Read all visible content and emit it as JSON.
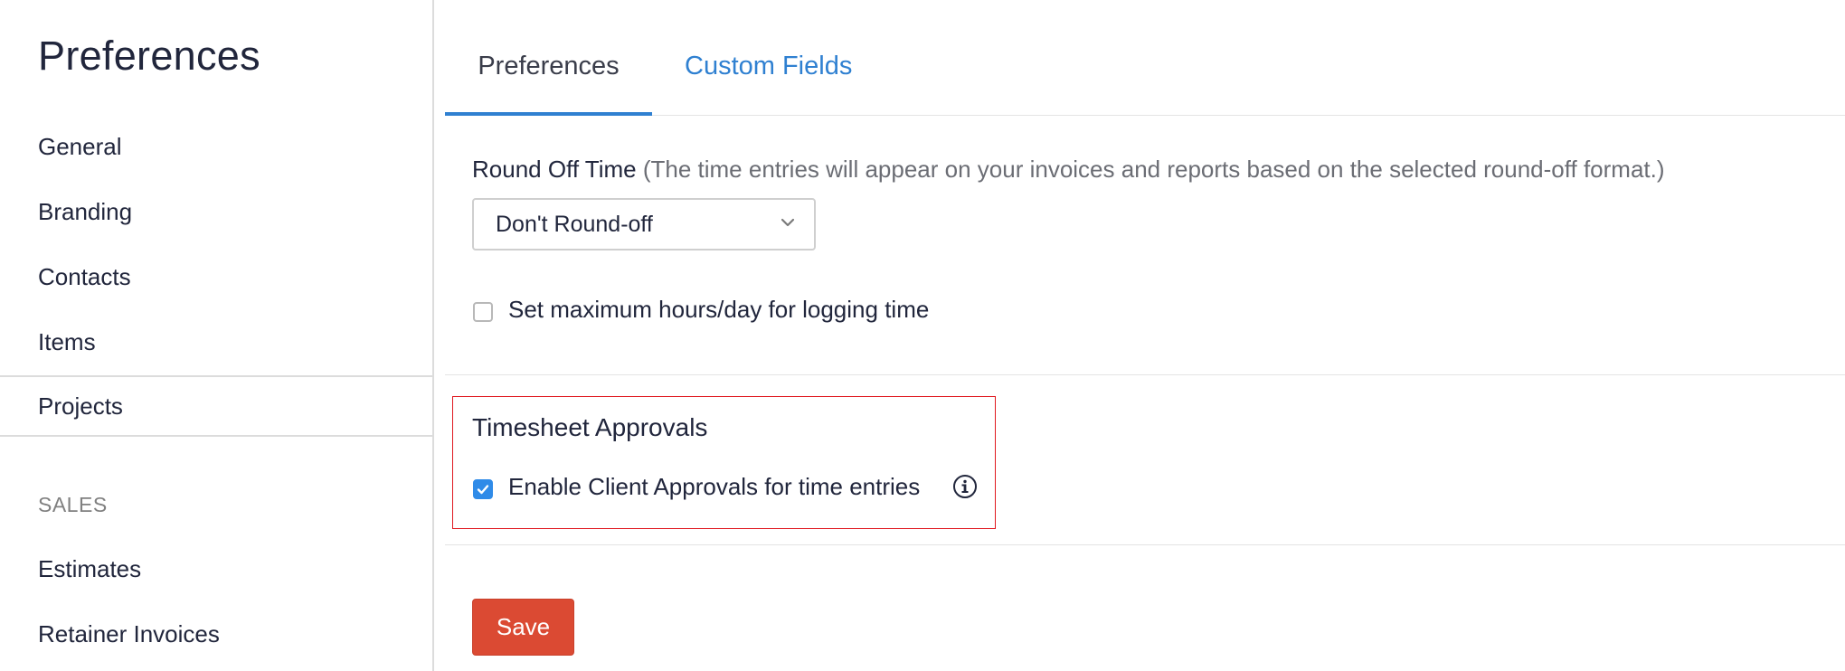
{
  "sidebar": {
    "title": "Preferences",
    "items": [
      {
        "label": "General"
      },
      {
        "label": "Branding"
      },
      {
        "label": "Contacts"
      },
      {
        "label": "Items"
      },
      {
        "label": "Projects",
        "active": true
      }
    ],
    "sections": [
      {
        "heading": "SALES",
        "items": [
          {
            "label": "Estimates"
          },
          {
            "label": "Retainer Invoices"
          }
        ]
      }
    ]
  },
  "tabs": [
    {
      "label": "Preferences",
      "active": true
    },
    {
      "label": "Custom Fields",
      "active": false
    }
  ],
  "form": {
    "round_off": {
      "label": "Round Off Time",
      "hint": "(The time entries will appear on your invoices and reports based on the selected round-off format.)",
      "selected": "Don't Round-off"
    },
    "max_hours": {
      "label": "Set maximum hours/day for logging time",
      "checked": false
    },
    "timesheet_approvals": {
      "title": "Timesheet Approvals",
      "client_approvals_label": "Enable Client Approvals for time entries",
      "checked": true
    },
    "save_label": "Save"
  },
  "icons": {
    "select_caret": "chevron-down-icon",
    "info": "info-icon",
    "check": "checkmark-icon"
  },
  "colors": {
    "accent": "#2f80d1",
    "checkbox_checked": "#2f8be8",
    "save_button": "#db4a33",
    "highlight_border": "#e0181f"
  }
}
